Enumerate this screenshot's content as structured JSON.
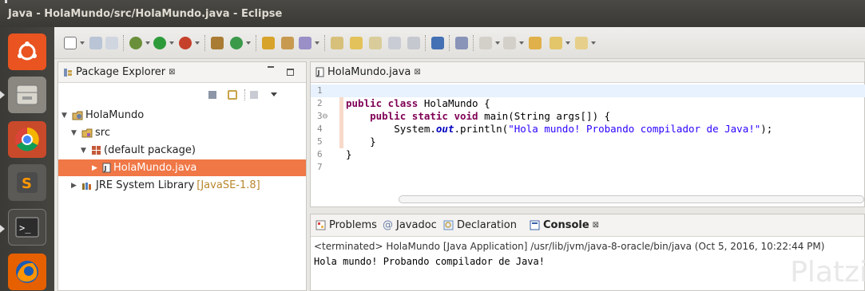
{
  "window": {
    "title": "Java - HolaMundo/src/HolaMundo.java - Eclipse"
  },
  "package_explorer": {
    "tab_label": "Package Explorer",
    "close": "⊠",
    "tree": {
      "project": "HolaMundo",
      "src": "src",
      "package": "(default package)",
      "file": "HolaMundo.java",
      "library": "JRE System Library",
      "library_version": "[JavaSE-1.8]"
    }
  },
  "editor": {
    "tab_label": "HolaMundo.java",
    "close": "⊠",
    "lines": [
      {
        "n": "1",
        "parts": []
      },
      {
        "n": "2",
        "parts": [
          [
            "kw",
            "public class"
          ],
          [
            "",
            " HolaMundo {"
          ]
        ]
      },
      {
        "n": "3⊖",
        "parts": [
          [
            "",
            "    "
          ],
          [
            "kw",
            "public static void"
          ],
          [
            "",
            " main(String args[]) {"
          ]
        ]
      },
      {
        "n": "4",
        "parts": [
          [
            "",
            "        System."
          ],
          [
            "fld",
            "out"
          ],
          [
            "",
            ".println("
          ],
          [
            "str",
            "\"Hola mundo! Probando compilador de Java!\""
          ],
          [
            "",
            ");"
          ]
        ]
      },
      {
        "n": "5",
        "parts": [
          [
            "",
            "    }"
          ]
        ]
      },
      {
        "n": "6",
        "parts": [
          [
            "",
            "}"
          ]
        ]
      },
      {
        "n": "7",
        "parts": []
      }
    ]
  },
  "console": {
    "tabs": {
      "problems": "Problems",
      "javadoc": "Javadoc",
      "declaration": "Declaration",
      "console": "Console"
    },
    "javadoc_prefix": "@",
    "close": "⊠",
    "status": "<terminated> HolaMundo [Java Application] /usr/lib/jvm/java-8-oracle/bin/java (Oct 5, 2016, 10:22:44 PM)",
    "output": "Hola mundo! Probando compilador de Java!"
  },
  "watermark": "Platzi",
  "launcher": {
    "items": [
      "ubuntu-dash",
      "files",
      "chrome",
      "sublime-text",
      "terminal",
      "firefox"
    ]
  },
  "colors": {
    "selection": "#f07746",
    "keyword": "#7f0055",
    "string": "#2a00ff",
    "field": "#0000c0"
  }
}
